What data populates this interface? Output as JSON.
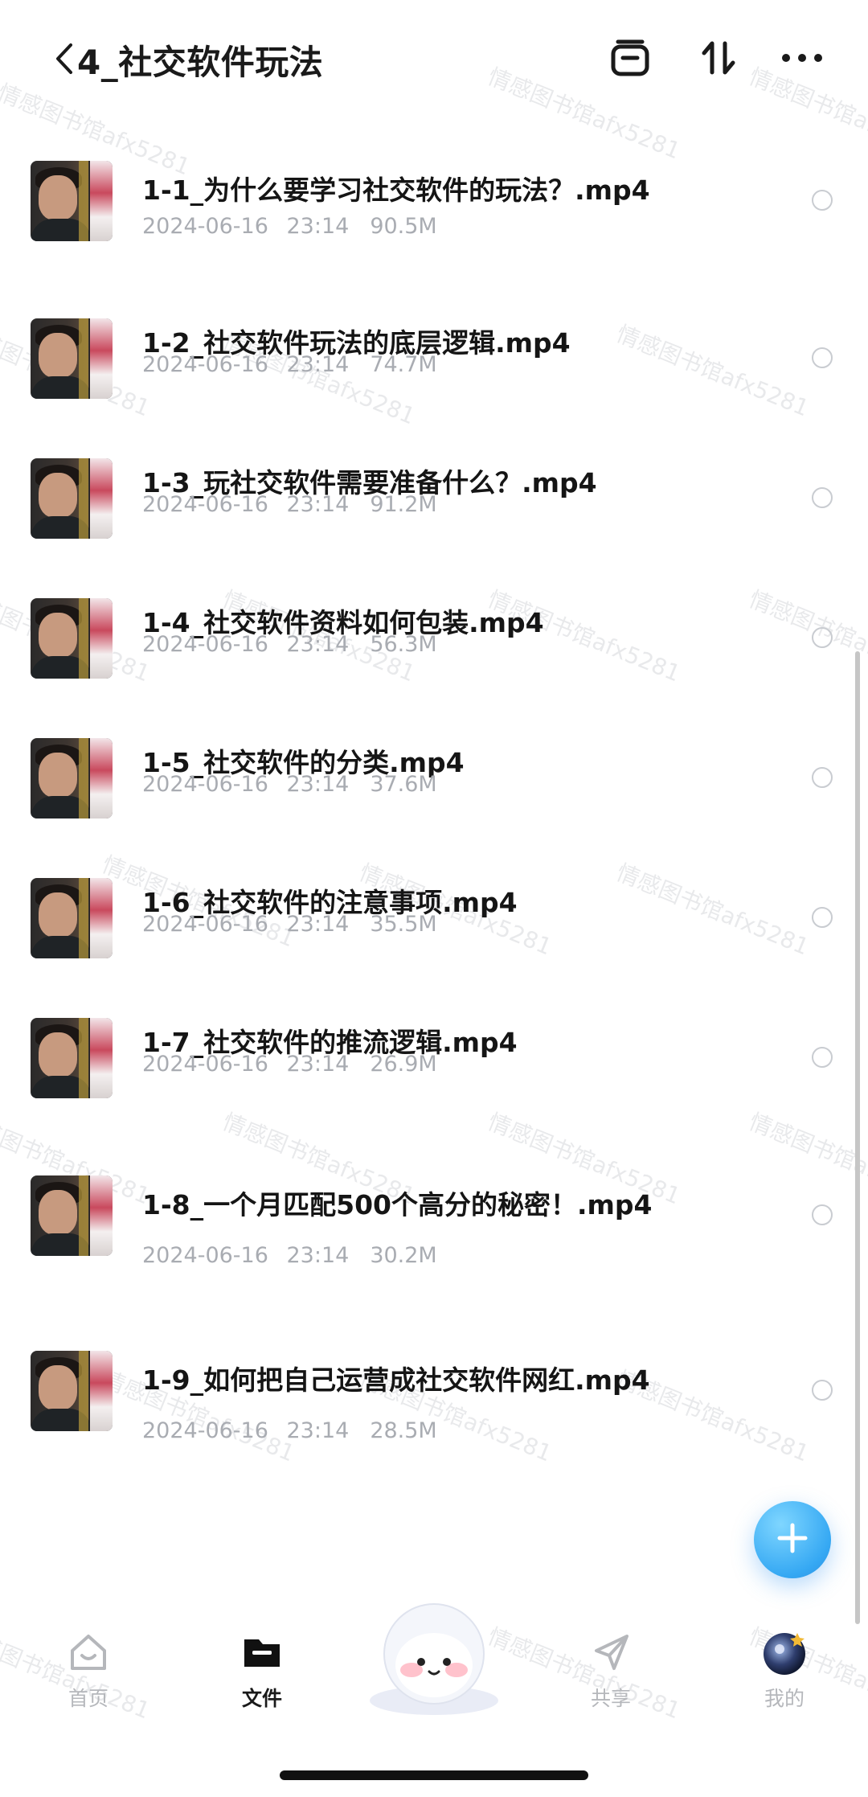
{
  "header": {
    "title": "4_社交软件玩法",
    "icons": [
      "back-icon",
      "archive-icon",
      "sort-icon",
      "more-icon"
    ]
  },
  "files": [
    {
      "name": "1-1_为什么要学习社交软件的玩法？.mp4",
      "date": "2024-06-16 23:14",
      "size": "90.5M"
    },
    {
      "name": "1-2_社交软件玩法的底层逻辑.mp4",
      "date": "2024-06-16 23:14",
      "size": "74.7M"
    },
    {
      "name": "1-3_玩社交软件需要准备什么？.mp4",
      "date": "2024-06-16 23:14",
      "size": "91.2M"
    },
    {
      "name": "1-4_社交软件资料如何包装.mp4",
      "date": "2024-06-16 23:14",
      "size": "56.3M"
    },
    {
      "name": "1-5_社交软件的分类.mp4",
      "date": "2024-06-16 23:14",
      "size": "37.6M"
    },
    {
      "name": "1-6_社交软件的注意事项.mp4",
      "date": "2024-06-16 23:14",
      "size": "35.5M"
    },
    {
      "name": "1-7_社交软件的推流逻辑.mp4",
      "date": "2024-06-16 23:14",
      "size": "26.9M"
    },
    {
      "name": "1-8_一个月匹配500个高分的秘密！.mp4",
      "date": "2024-06-16 23:14",
      "size": "30.2M"
    },
    {
      "name": "1-9_如何把自己运营成社交软件网红.mp4",
      "date": "2024-06-16 23:14",
      "size": "28.5M"
    }
  ],
  "fab": {
    "icon": "plus-icon"
  },
  "bottom_nav": {
    "items": [
      {
        "label": "首页",
        "icon": "home-icon",
        "active": false
      },
      {
        "label": "文件",
        "icon": "folder-icon",
        "active": true
      },
      {
        "label": "共享",
        "icon": "share-icon",
        "active": false
      },
      {
        "label": "我的",
        "icon": "avatar-icon",
        "active": false
      }
    ]
  },
  "watermark": "情感图书馆afx5281",
  "colors": {
    "accent": "#35a8f3",
    "meta_text": "#a9acb2",
    "title_text": "#151515"
  }
}
